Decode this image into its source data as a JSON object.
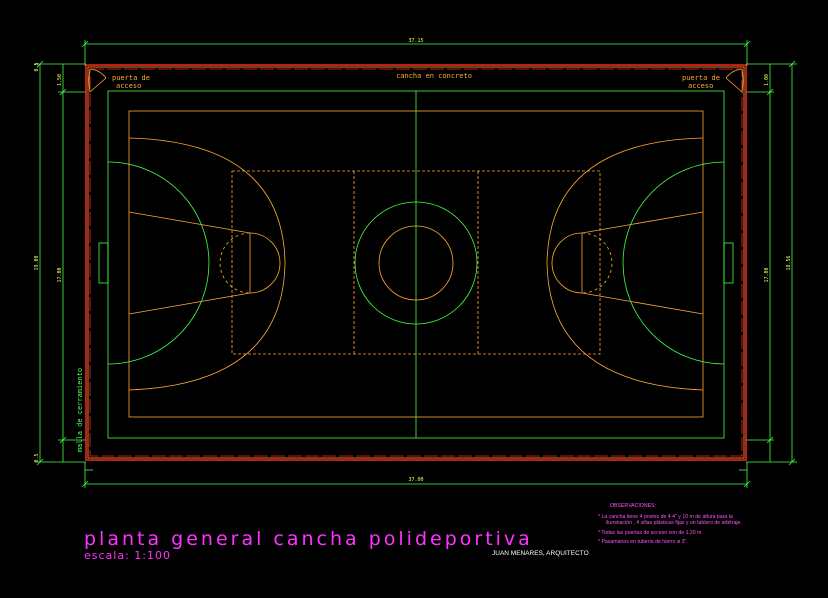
{
  "labels": {
    "cancha": "cancha en concreto",
    "puerta_left_1": "puerta de",
    "puerta_left_2": "acceso",
    "puerta_right_1": "puerta de",
    "puerta_right_2": "acceso",
    "malla": "malla de cerramiento"
  },
  "dimensions": {
    "top_total": "37.15",
    "bottom_total": "37.00",
    "left_outer": "19.00",
    "left_inner": "17.00",
    "right_outer": "18.56",
    "right_inner": "17.00",
    "side_small_a": "1.50",
    "side_small_b": "1.00",
    "side_tiny": "0.5",
    "side_tiny_bottom": "0.5"
  },
  "title": {
    "main": "planta general cancha polideportiva",
    "scale": "escala: 1:100",
    "author": "JUAN MENARES, ARQUITECTO"
  },
  "observaciones": {
    "heading": "OBSERVACIONES:",
    "notes": [
      "* La cancha tiene 4 postes de 4 4\" y 10 m de altura para la iluminación , 4 sillas plásticas fijas y un tablero de arbitraje.",
      "* Todas las puertas de acceso son de 1.20 m",
      "* Pasamanos en tubería de hierro ø 3\"."
    ]
  },
  "colors": {
    "background": "#000000",
    "green": "#44ff44",
    "orange": "#ffaa33",
    "red": "#ff2222",
    "yellow_dim": "#ffff66",
    "magenta": "#ff33ff"
  }
}
